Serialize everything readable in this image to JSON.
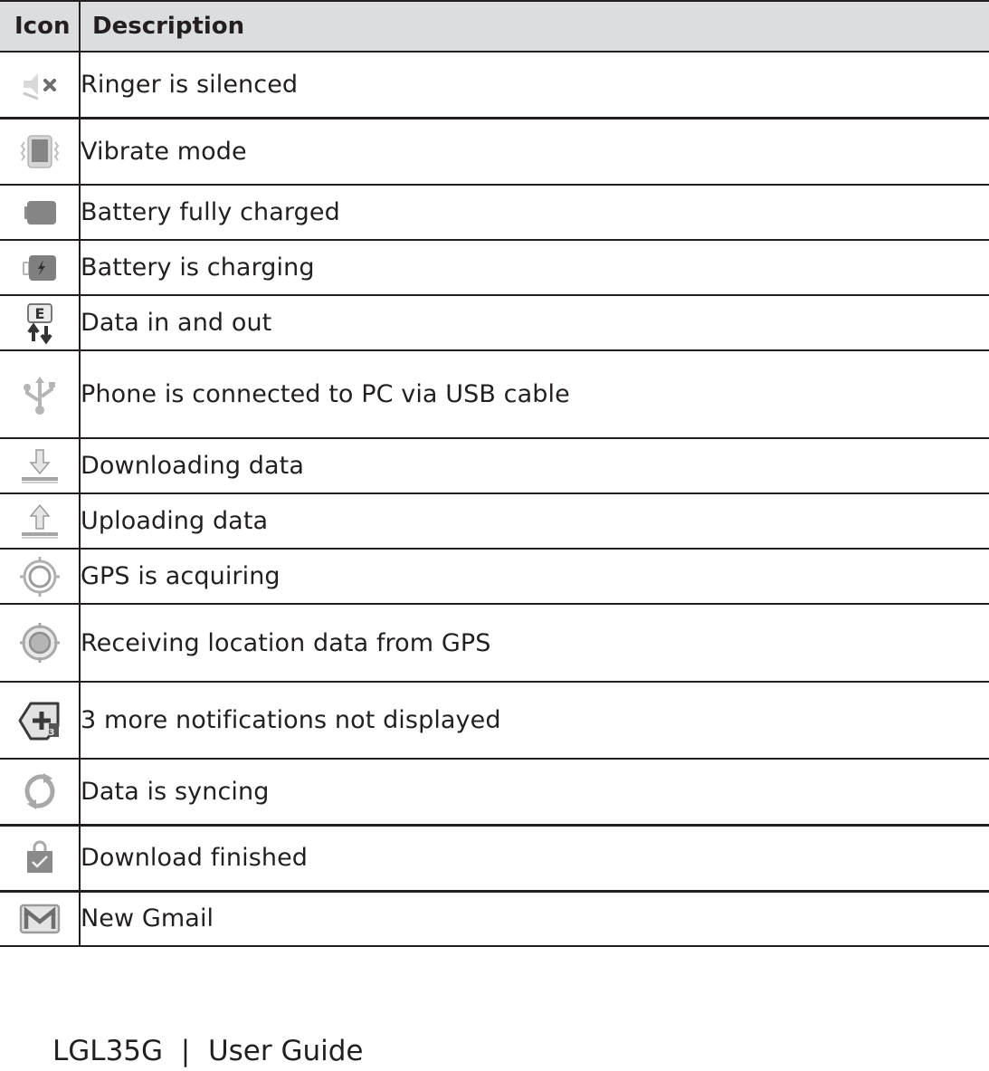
{
  "table": {
    "headers": {
      "icon": "Icon",
      "description": "Description"
    },
    "rows": [
      {
        "icon": "ringer-silenced-icon",
        "description": "Ringer is silenced"
      },
      {
        "icon": "vibrate-mode-icon",
        "description": "Vibrate mode"
      },
      {
        "icon": "battery-full-icon",
        "description": "Battery fully charged"
      },
      {
        "icon": "battery-charging-icon",
        "description": "Battery is charging"
      },
      {
        "icon": "data-in-out-icon",
        "description": "Data in and out",
        "icon_letter": "E"
      },
      {
        "icon": "usb-icon",
        "description": "Phone is connected to PC via USB cable"
      },
      {
        "icon": "download-icon",
        "description": "Downloading data"
      },
      {
        "icon": "upload-icon",
        "description": "Uploading data"
      },
      {
        "icon": "gps-acquiring-icon",
        "description": "GPS is acquiring"
      },
      {
        "icon": "gps-receiving-icon",
        "description": "Receiving location data from GPS"
      },
      {
        "icon": "more-notifications-icon",
        "description": "3 more notifications not displayed",
        "icon_badge": "3"
      },
      {
        "icon": "sync-icon",
        "description": "Data is syncing"
      },
      {
        "icon": "download-finished-icon",
        "description": "Download finished"
      },
      {
        "icon": "gmail-icon",
        "description": "New Gmail"
      }
    ]
  },
  "footer": {
    "model": "LGL35G",
    "separator": "|",
    "title": "User Guide"
  },
  "colors": {
    "header_bg": "#dcdddf",
    "rule": "#231f20",
    "icon_gray": "#8a8a8a"
  }
}
